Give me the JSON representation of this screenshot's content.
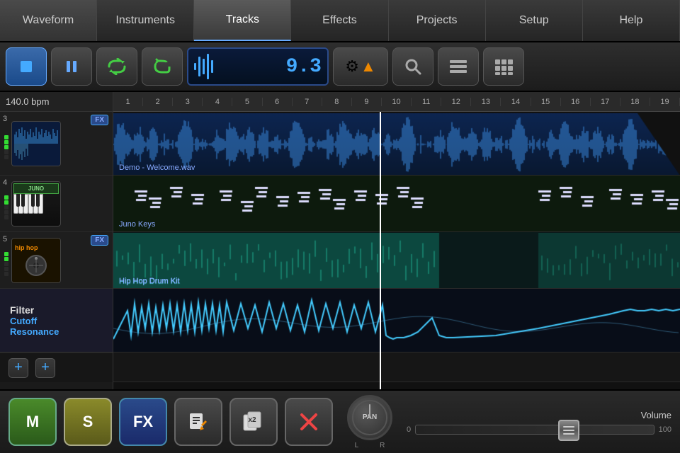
{
  "nav": {
    "items": [
      {
        "id": "waveform",
        "label": "Waveform",
        "active": false
      },
      {
        "id": "instruments",
        "label": "Instruments",
        "active": false
      },
      {
        "id": "tracks",
        "label": "Tracks",
        "active": true
      },
      {
        "id": "effects",
        "label": "Effects",
        "active": false
      },
      {
        "id": "projects",
        "label": "Projects",
        "active": false
      },
      {
        "id": "setup",
        "label": "Setup",
        "active": false
      },
      {
        "id": "help",
        "label": "Help",
        "active": false
      }
    ]
  },
  "toolbar": {
    "position": "9.3",
    "bpm": "140.0 bpm"
  },
  "tracks": [
    {
      "num": "3",
      "name": "Demo - Welcome.wav",
      "type": "audio",
      "hasFX": true
    },
    {
      "num": "4",
      "name": "Juno Keys",
      "type": "midi",
      "hasFX": false
    },
    {
      "num": "5",
      "name": "Hip Hop Drum Kit",
      "type": "drums",
      "hasFX": true
    }
  ],
  "filter": {
    "title": "Filter",
    "cutoff": "Cutoff",
    "resonance": "Resonance"
  },
  "ruler": {
    "numbers": [
      "1",
      "2",
      "3",
      "4",
      "5",
      "6",
      "7",
      "8",
      "9",
      "10",
      "11",
      "12",
      "13",
      "14",
      "15",
      "16",
      "17",
      "18",
      "19"
    ]
  },
  "bottom": {
    "m_label": "M",
    "s_label": "S",
    "fx_label": "FX",
    "pan_label": "PAN",
    "volume_label": "Volume",
    "vol_min": "0",
    "vol_max": "100"
  }
}
